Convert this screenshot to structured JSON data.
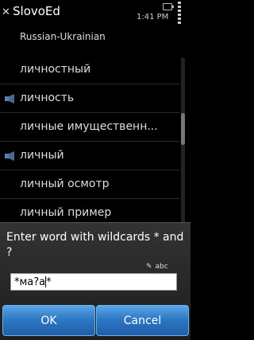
{
  "header": {
    "app_title": "SlovoEd",
    "time": "1:41 PM",
    "dictionary": "Russian-Ukrainian"
  },
  "list": {
    "items": [
      {
        "label": "личностный",
        "has_audio": false
      },
      {
        "label": "личность",
        "has_audio": true
      },
      {
        "label": "личные имущественн...",
        "has_audio": false
      },
      {
        "label": "личный",
        "has_audio": true
      },
      {
        "label": "личный осмотр",
        "has_audio": false
      },
      {
        "label": "личный пример",
        "has_audio": false
      }
    ]
  },
  "dialog": {
    "title": "Enter word with wildcards * and ?",
    "input_mode": "abc",
    "input_value_before_caret": "*ма?а",
    "input_value_after_caret": "*",
    "ok_label": "OK",
    "cancel_label": "Cancel"
  },
  "colors": {
    "button_blue": "#2f78c4",
    "background": "#000000"
  }
}
